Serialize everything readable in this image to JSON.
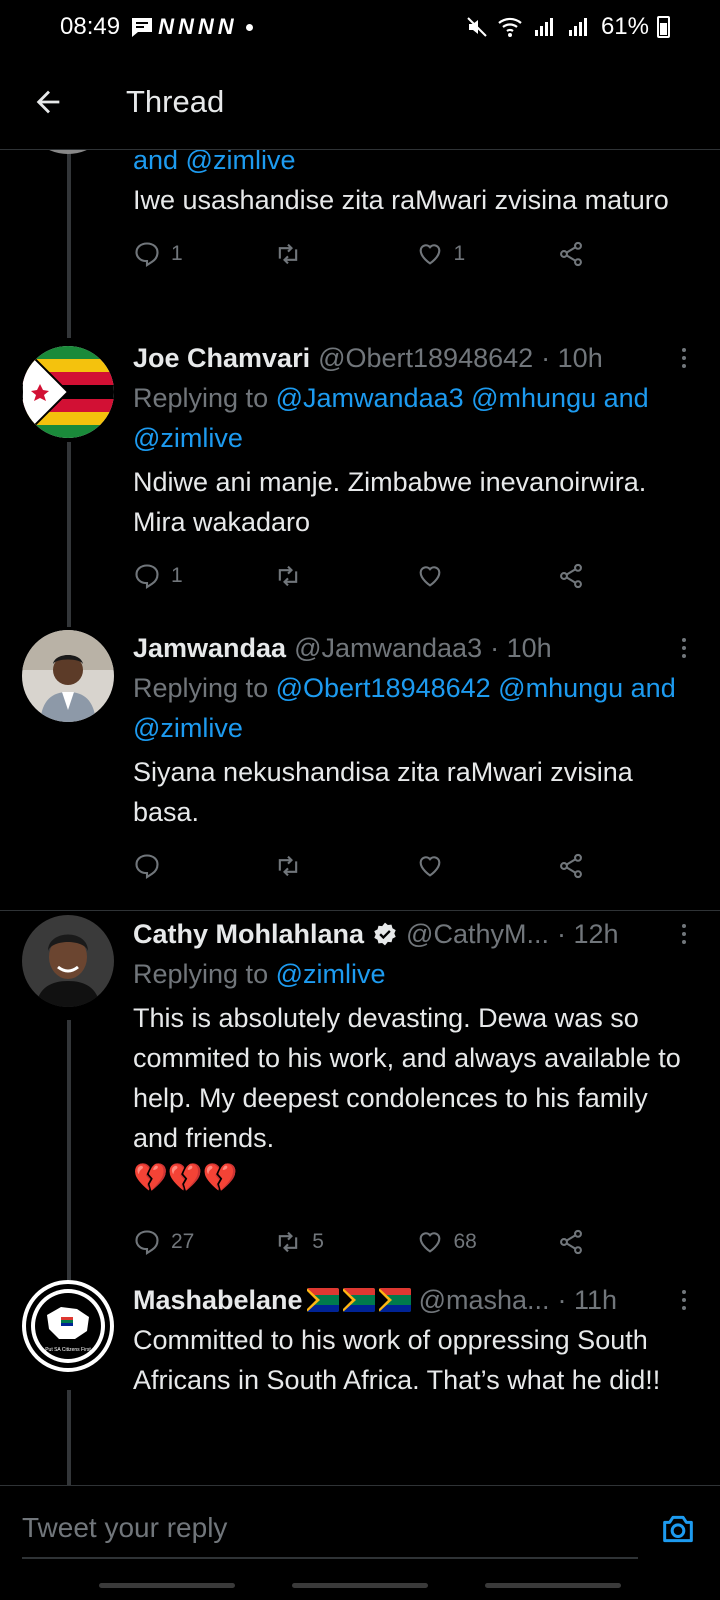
{
  "status_bar": {
    "time": "08:49",
    "notification_letters": [
      "N",
      "N",
      "N",
      "N"
    ],
    "battery": "61%"
  },
  "header": {
    "title": "Thread"
  },
  "tweets": [
    {
      "reply_to_continued": "and @zimlive",
      "body": "Iwe usashandise zita raMwari zvisina maturo",
      "replies": "1",
      "retweets": "",
      "likes": "1"
    },
    {
      "name": "Joe Chamvari",
      "handle": "@Obert18948642",
      "time": "· 10h",
      "replying_label": "Replying to",
      "mentions": "@Jamwandaa3 @mhungu and @zimlive",
      "body": "Ndiwe ani manje. Zimbabwe inevanoirwira. Mira wakadaro",
      "replies": "1",
      "retweets": "",
      "likes": ""
    },
    {
      "name": "Jamwandaa",
      "handle": "@Jamwandaa3",
      "time": "· 10h",
      "replying_label": "Replying to",
      "mentions": "@Obert18948642 @mhungu and @zimlive",
      "body": "Siyana nekushandisa zita raMwari zvisina basa.",
      "replies": "",
      "retweets": "",
      "likes": ""
    },
    {
      "name": "Cathy Mohlahlana",
      "handle": "@CathyM...",
      "time": "· 12h",
      "replying_label": "Replying to",
      "mentions": "@zimlive",
      "body": "This is absolutely devasting. Dewa was so commited to his work, and always available to help. My deepest condolences to his family and friends.",
      "emoji": "💔💔💔",
      "replies": "27",
      "retweets": "5",
      "likes": "68"
    },
    {
      "name": "Mashabelane",
      "handle": "@masha...",
      "time": "· 11h",
      "body": "Committed to his work of oppressing South Africans in South Africa. That’s what he did!!",
      "avatar_text": "Put SA Citizens First"
    }
  ],
  "reply_bar": {
    "placeholder": "Tweet your reply"
  },
  "icons": {
    "back": "back-arrow-icon",
    "reply": "comment-icon",
    "retweet": "retweet-icon",
    "like": "heart-icon",
    "share": "share-icon",
    "camera": "camera-icon",
    "verified": "verified-badge-icon"
  },
  "colors": {
    "background": "#000000",
    "text": "#e7e9ea",
    "muted": "#71767b",
    "link": "#1d9bf0"
  }
}
